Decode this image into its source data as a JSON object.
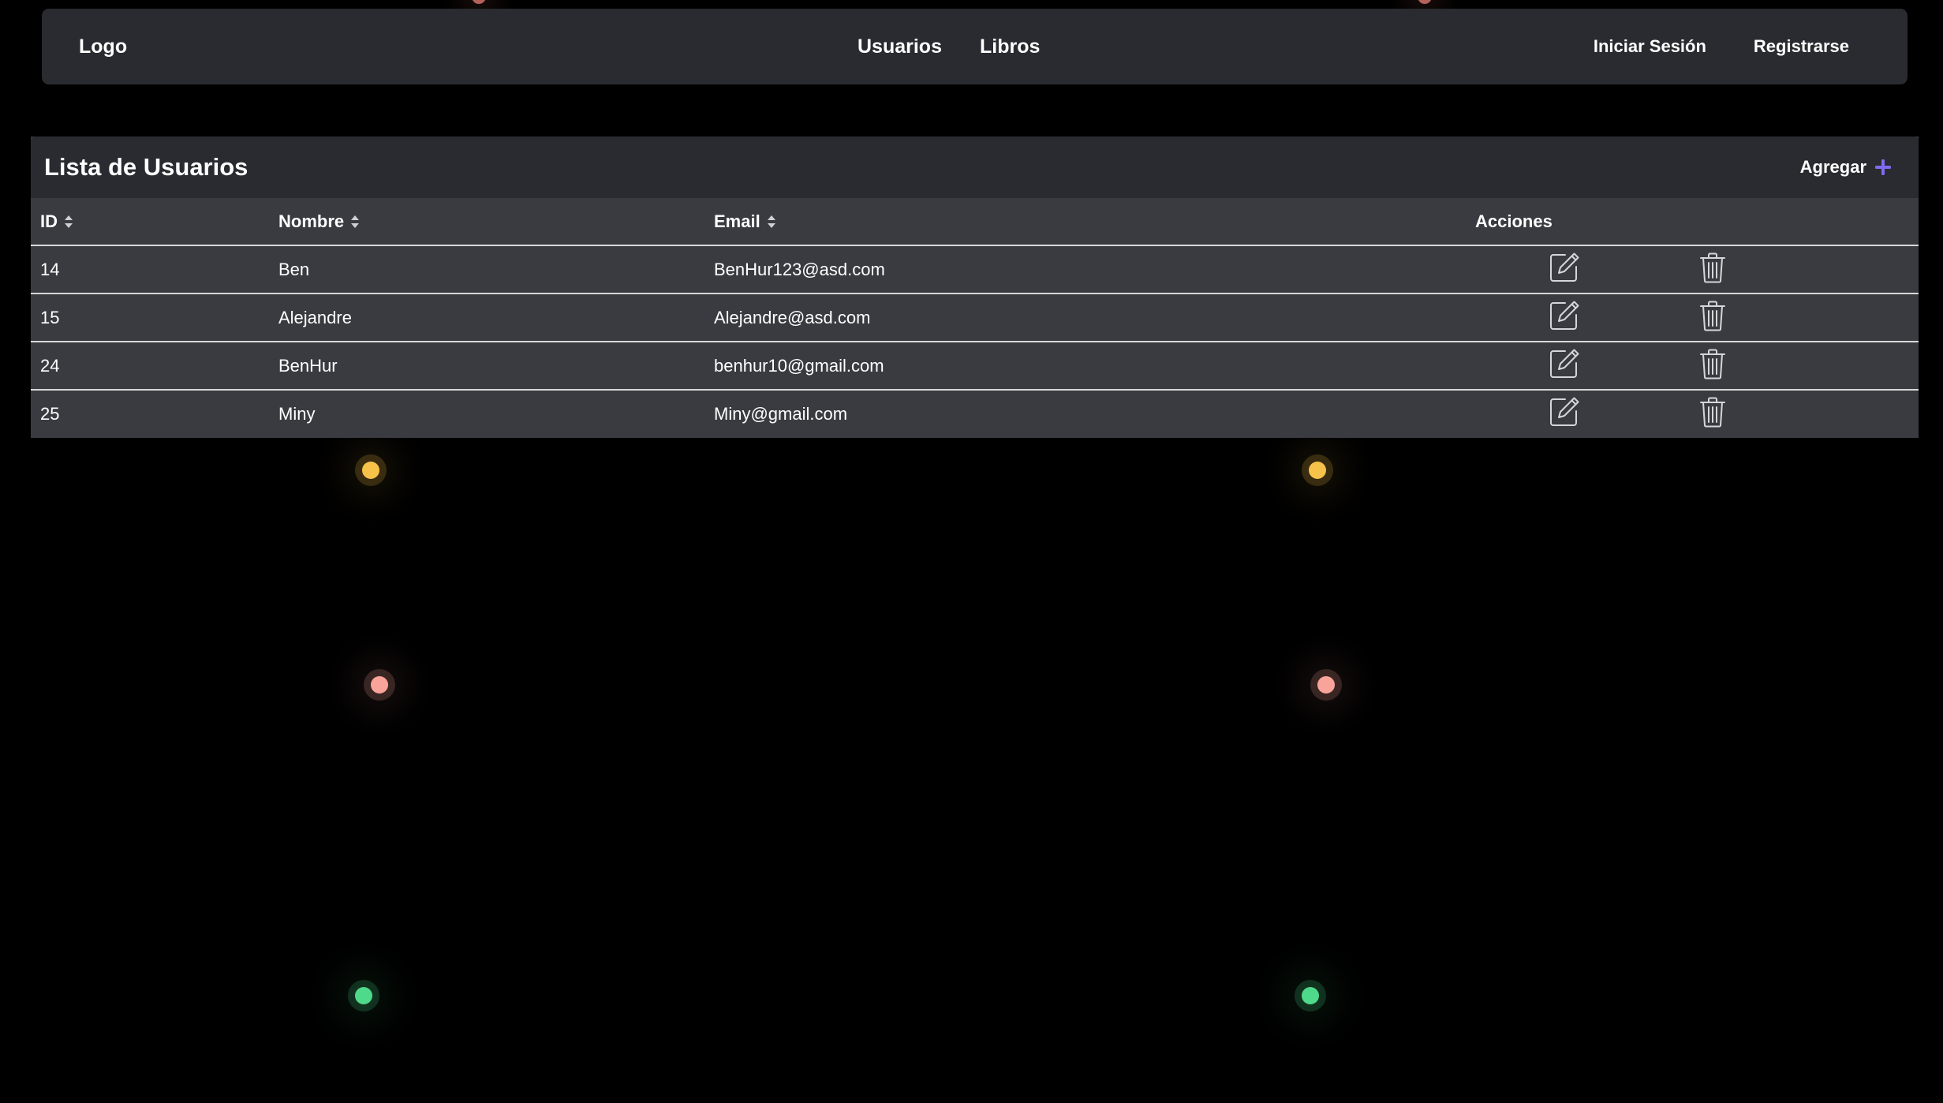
{
  "navbar": {
    "logo": "Logo",
    "links": [
      "Usuarios",
      "Libros"
    ],
    "login": "Iniciar Sesión",
    "register": "Registrarse"
  },
  "users_card": {
    "title": "Lista de Usuarios",
    "add_label": "Agregar",
    "accent_color": "#7c6cf0",
    "columns": [
      "ID",
      "Nombre",
      "Email",
      "Acciones"
    ],
    "rows": [
      {
        "id": "14",
        "name": "Ben",
        "email": "BenHur123@asd.com"
      },
      {
        "id": "15",
        "name": "Alejandre",
        "email": "Alejandre@asd.com"
      },
      {
        "id": "24",
        "name": "BenHur",
        "email": "benhur10@gmail.com"
      },
      {
        "id": "25",
        "name": "Miny",
        "email": "Miny@gmail.com"
      }
    ],
    "row_actions": [
      "edit-icon",
      "trash-icon"
    ]
  },
  "background": {
    "color": "#000000",
    "dot_colors": [
      "#f7c24a",
      "#f9a49a",
      "#4fd98a"
    ]
  }
}
